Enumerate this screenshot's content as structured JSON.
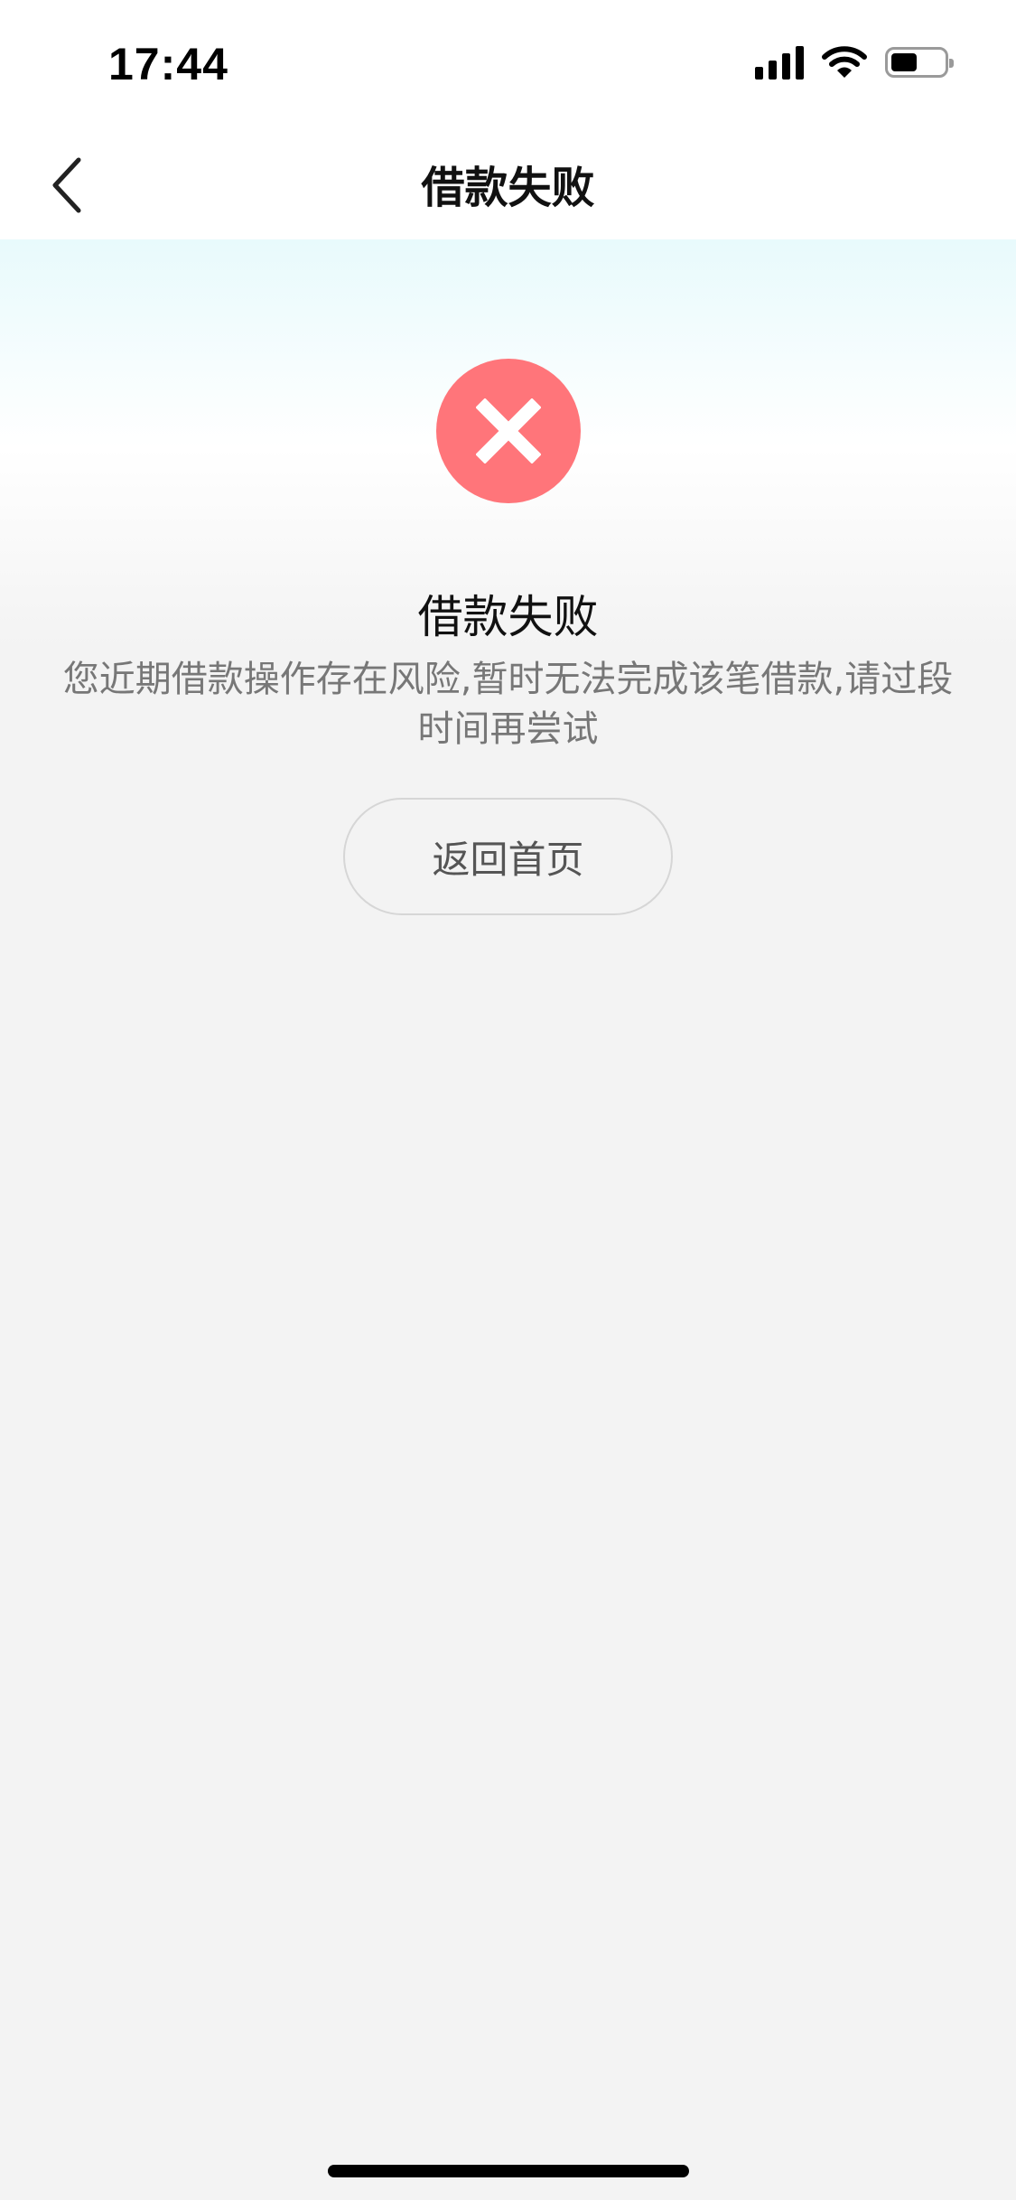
{
  "status_bar": {
    "time": "17:44",
    "icons": [
      "cellular-signal-icon",
      "wifi-icon",
      "battery-icon"
    ],
    "battery_level": 0.5
  },
  "nav": {
    "title": "借款失败",
    "back_icon": "chevron-left-icon"
  },
  "result": {
    "icon": "close-icon",
    "icon_color": "#ff757a",
    "title": "借款失败",
    "description": "您近期借款操作存在风险,暂时无法完成该笔借款,请过段时间再尝试",
    "button_label": "返回首页"
  }
}
